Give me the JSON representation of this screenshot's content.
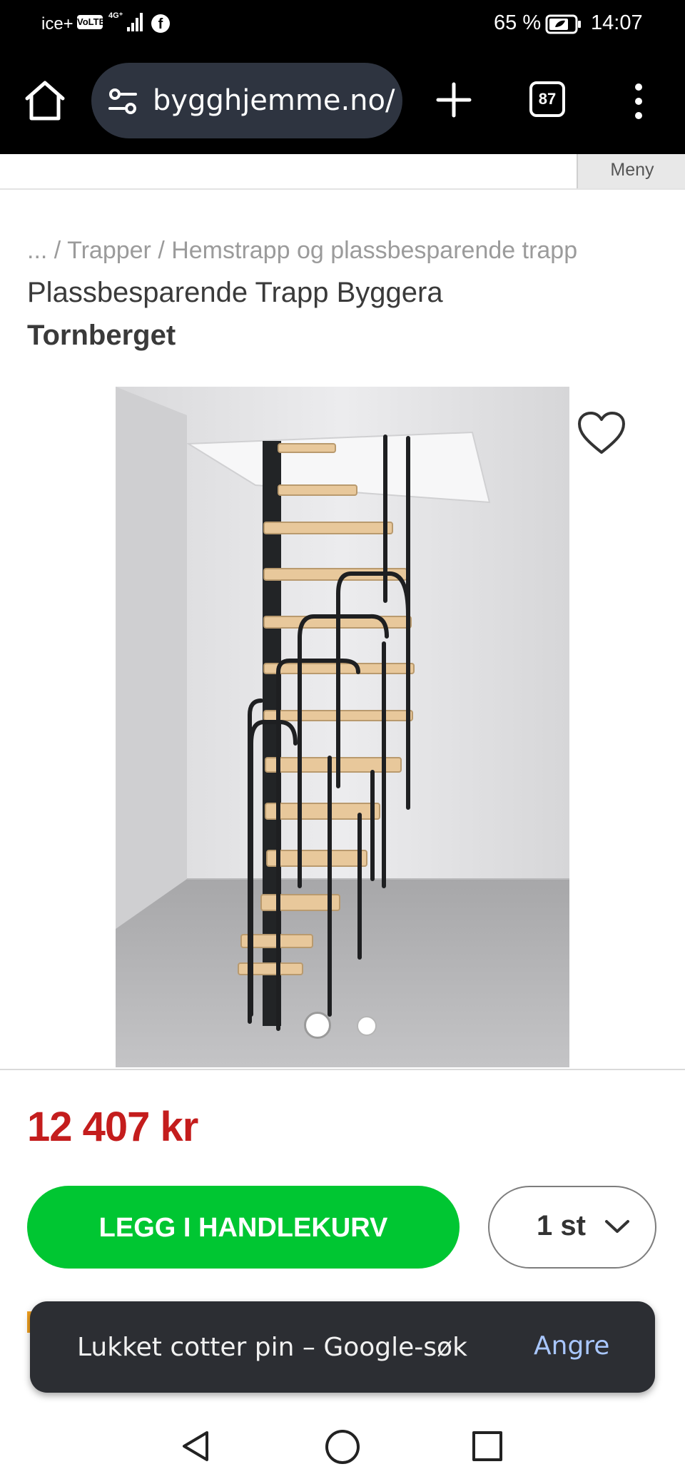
{
  "status_bar": {
    "carrier": "ice+",
    "volte": "VoLTE",
    "network": "4G+",
    "facebook_icon": "f",
    "battery_percent": "65 %",
    "time": "14:07"
  },
  "browser": {
    "url": "bygghjemme.no/",
    "tab_count": "87",
    "icons": [
      "home-icon",
      "site-settings-icon",
      "new-tab-icon",
      "tab-switcher-icon",
      "more-vert-icon"
    ]
  },
  "site_header": {
    "menu_label": "Meny"
  },
  "product": {
    "breadcrumb": {
      "ellipsis": "...",
      "separator": " / ",
      "items": [
        "Trapper",
        "Hemstrapp og plassbesparende trapp"
      ]
    },
    "title": "Plassbesparende Trapp Byggera",
    "brand": "Tornberget",
    "image_count": 2,
    "active_image": 1,
    "price": "12 407 kr",
    "add_to_cart_label": "LEGG I HANDLEKURV",
    "quantity": "1 st"
  },
  "snackbar": {
    "message": "Lukket cotter pin – Google-søk",
    "action": "Angre"
  },
  "colors": {
    "price": "#c41d1d",
    "cta": "#00c632",
    "snackbar_bg": "#2c2e33",
    "snackbar_action": "#a9c7ff"
  }
}
